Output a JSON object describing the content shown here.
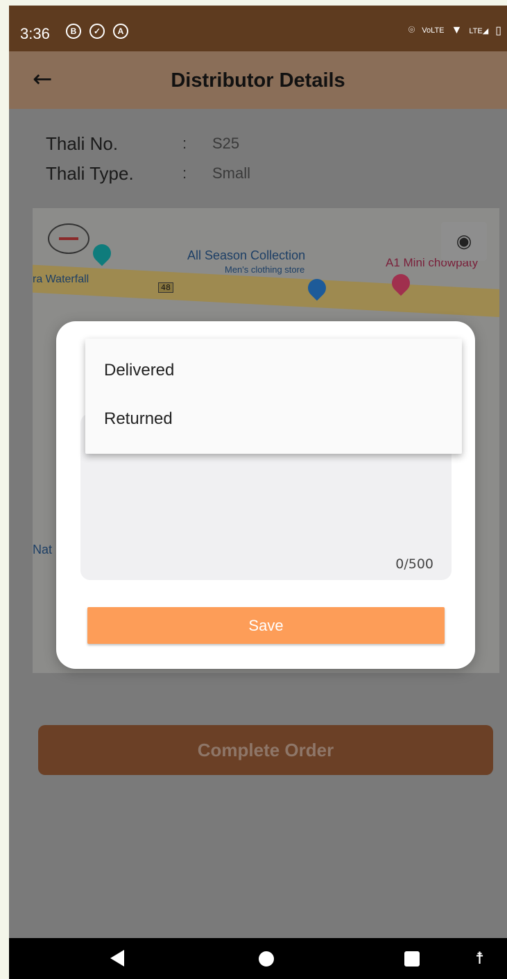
{
  "status_bar": {
    "time": "3:36",
    "icons": [
      "b-circle-icon",
      "shield-check-icon",
      "a-circle-icon"
    ],
    "right_icons": [
      "location-pin-icon",
      "volte-icon",
      "wifi-icon",
      "lte-signal-icon",
      "battery-icon"
    ]
  },
  "app_bar": {
    "title": "Distributor Details"
  },
  "details": {
    "thali_no_label": "Thali No.",
    "thali_no_value": "S25",
    "thali_type_label": "Thali Type.",
    "thali_type_value": "Small",
    "separator": ":"
  },
  "map": {
    "labels": [
      "All Season Collection",
      "Men's clothing store",
      "A1 Mini chowpaty",
      "ra Waterfall",
      "48",
      "Nat"
    ]
  },
  "dialog": {
    "counter": "0/500",
    "save_label": "Save",
    "options": [
      "Delivered",
      "Returned"
    ]
  },
  "complete_order_label": "Complete Order",
  "colors": {
    "status_bar": "#5e3b1f",
    "accent": "#fd9d58",
    "complete_button": "#6b4026"
  }
}
